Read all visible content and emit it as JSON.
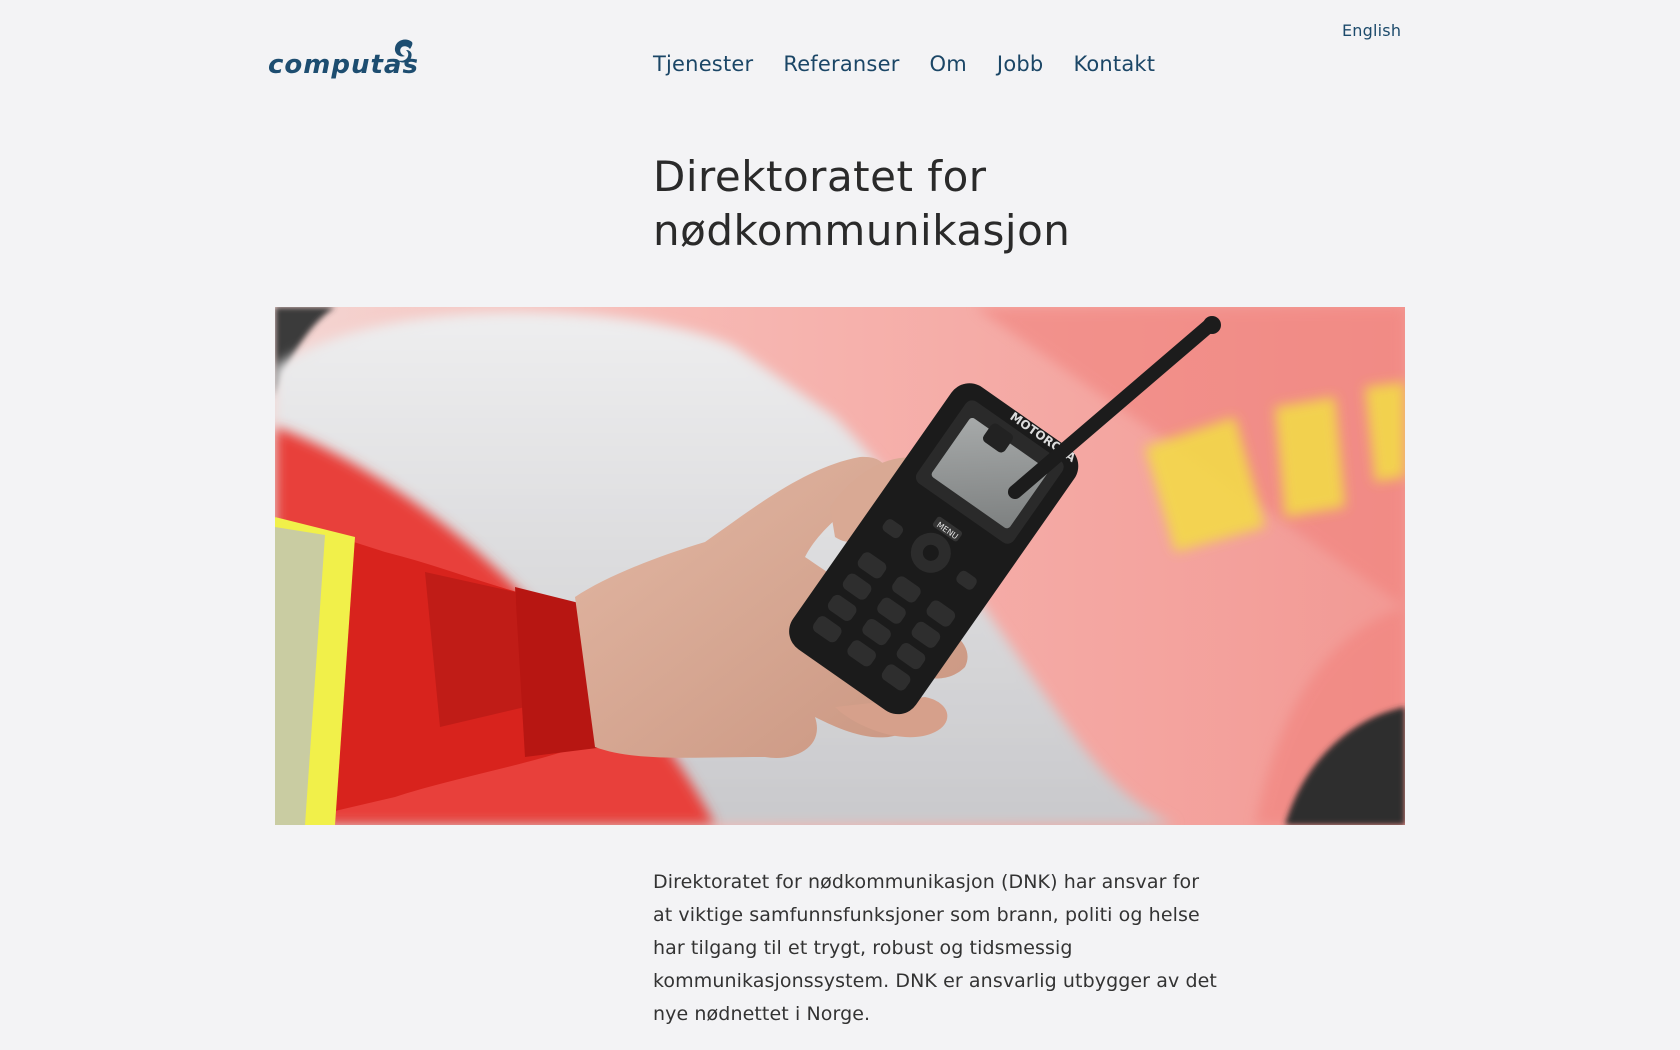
{
  "header": {
    "language_link": "English",
    "logo_text": "computas",
    "nav": [
      {
        "label": "Tjenester"
      },
      {
        "label": "Referanser"
      },
      {
        "label": "Om"
      },
      {
        "label": "Jobb"
      },
      {
        "label": "Kontakt"
      }
    ]
  },
  "main": {
    "title": "Direktoratet for nødkommunikasjon",
    "hero": {
      "radio_brand": "MOTOROLA",
      "radio_menu_key": "MENU",
      "icon": "hand-holding-radio-photo"
    },
    "intro": "Direktoratet for nødkommunikasjon (DNK) har ansvar for at viktige samfunnsfunksjoner som brann, politi og helse har tilgang til et trygt, robust og tidsmessig kommunikasjonssystem. DNK er ansvarlig utbygger av det nye nødnettet i Norge."
  },
  "colors": {
    "background": "#f3f3f5",
    "nav_link": "#1b4666",
    "brand": "#1d4d70"
  }
}
